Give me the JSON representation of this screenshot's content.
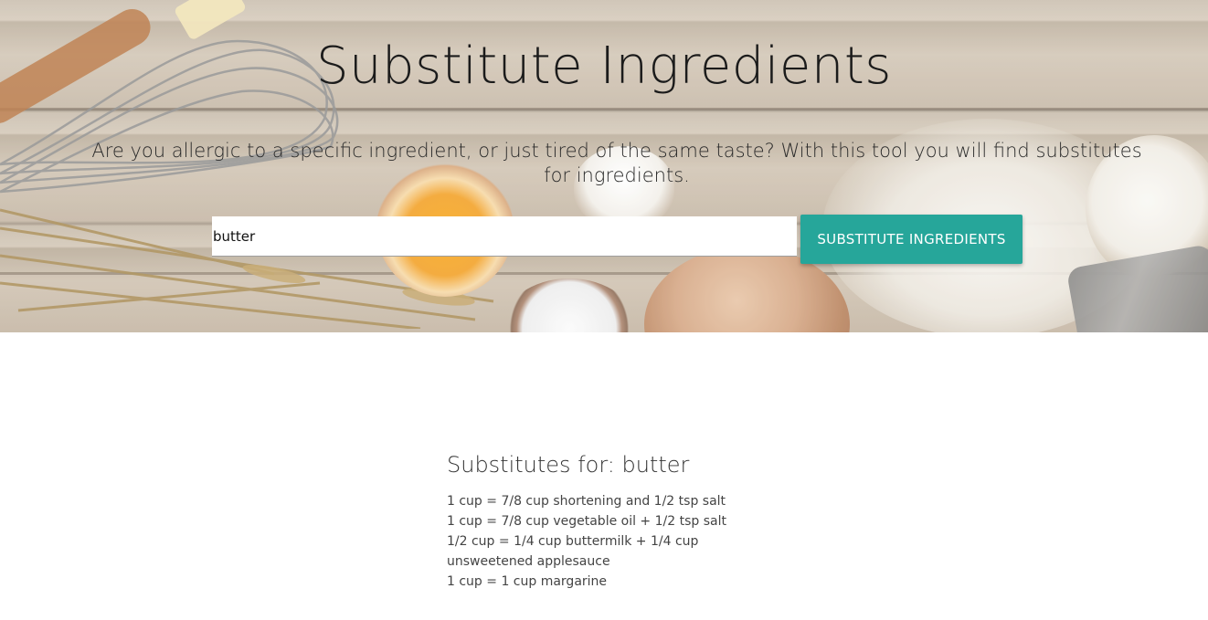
{
  "hero": {
    "title": "Substitute Ingredients",
    "subtitle": "Are you allergic to a specific ingredient, or just tired of the same taste? With this tool you will find substitutes for ingredients."
  },
  "search": {
    "value": "butter",
    "button_label": "SUBSTITUTE INGREDIENTS"
  },
  "results": {
    "heading": "Substitutes for: butter",
    "items": [
      "1 cup = 7/8 cup shortening and 1/2 tsp salt",
      "1 cup = 7/8 cup vegetable oil + 1/2 tsp salt",
      "1/2 cup = 1/4 cup buttermilk + 1/4 cup unsweetened applesauce",
      "1 cup = 1 cup margarine"
    ]
  },
  "colors": {
    "accent": "#26a69a",
    "text": "#1b1b1b"
  }
}
